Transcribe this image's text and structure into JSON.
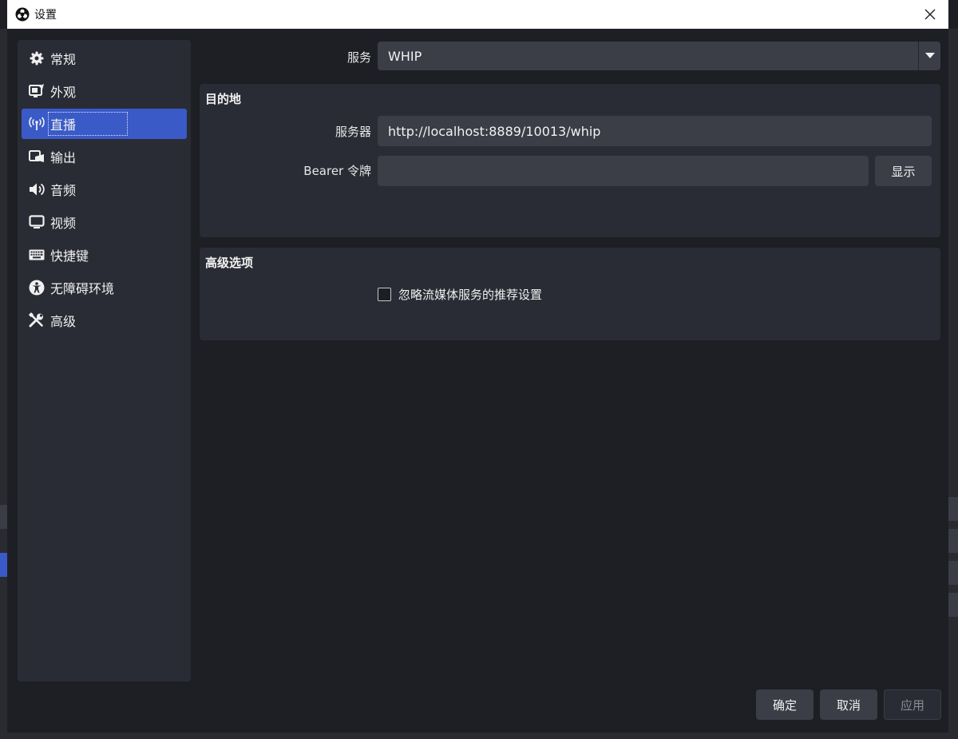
{
  "window": {
    "title": "设置",
    "close_icon": "close-icon"
  },
  "sidebar": {
    "items": [
      {
        "label": "常规",
        "icon": "gear-icon"
      },
      {
        "label": "外观",
        "icon": "appearance-icon"
      },
      {
        "label": "直播",
        "icon": "broadcast-icon",
        "active": true
      },
      {
        "label": "输出",
        "icon": "output-icon"
      },
      {
        "label": "音频",
        "icon": "speaker-icon"
      },
      {
        "label": "视频",
        "icon": "monitor-icon"
      },
      {
        "label": "快捷键",
        "icon": "keyboard-icon"
      },
      {
        "label": "无障碍环境",
        "icon": "accessibility-icon"
      },
      {
        "label": "高级",
        "icon": "tools-icon"
      }
    ]
  },
  "stream": {
    "service_label": "服务",
    "service_value": "WHIP",
    "destination": {
      "title": "目的地",
      "server_label": "服务器",
      "server_value": "http://localhost:8889/10013/whip",
      "token_label": "Bearer 令牌",
      "token_value": "",
      "show_button": "显示"
    },
    "advanced": {
      "title": "高级选项",
      "ignore_checkbox_label": "忽略流媒体服务的推荐设置",
      "ignore_checked": false
    }
  },
  "footer": {
    "ok_label": "确定",
    "cancel_label": "取消",
    "apply_label": "应用"
  },
  "colors": {
    "accent": "#3a5ac8",
    "background": "#1e1f24",
    "panel": "#2a2c35",
    "input": "#3b3d47"
  }
}
